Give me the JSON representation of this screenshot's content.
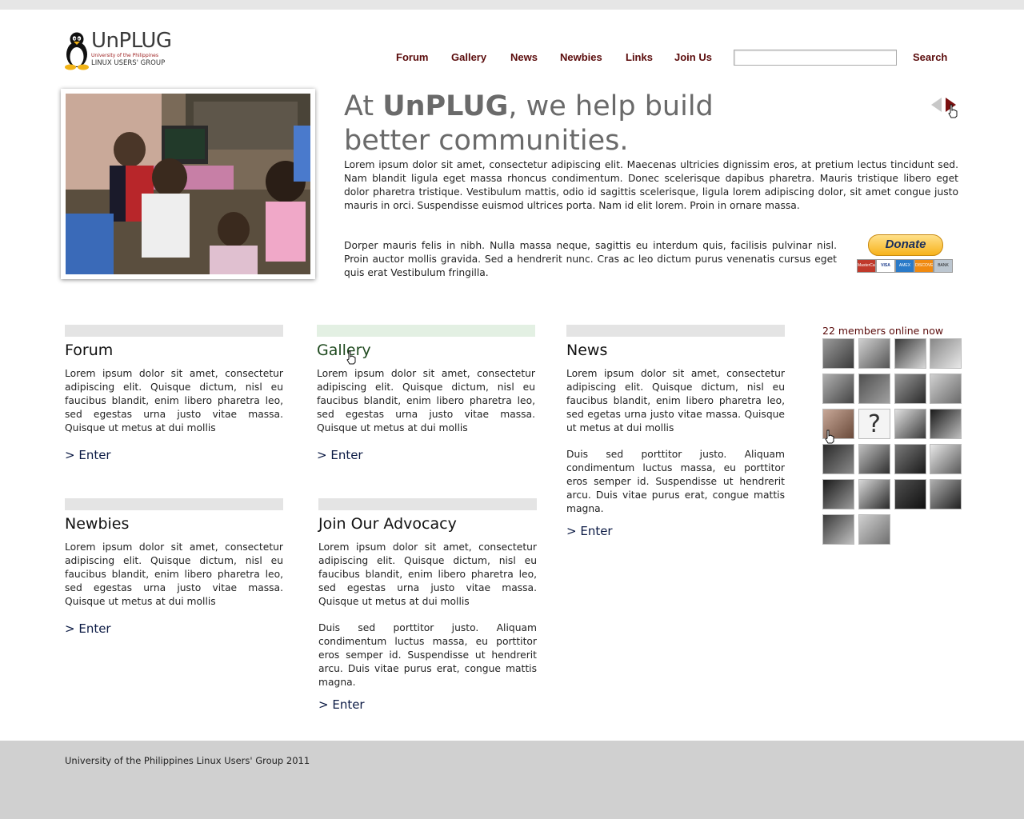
{
  "brand": {
    "name": "UnPLUG",
    "subtitle1": "University of the Philippines",
    "subtitle2": "LINUX USERS' GROUP"
  },
  "nav": {
    "items": [
      "Forum",
      "Gallery",
      "News",
      "Newbies",
      "Links",
      "Join Us"
    ]
  },
  "search": {
    "value": "",
    "button_label": "Search"
  },
  "hero": {
    "title_prefix": "At ",
    "title_brand": "UnPLUG",
    "title_rest": ", we help build better communities.",
    "paragraph1": "Lorem ipsum dolor sit amet, consectetur adipiscing elit. Maecenas ultricies dignissim eros, at pretium lectus tincidunt sed. Nam blandit ligula eget massa rhoncus condimentum. Donec scelerisque dapibus pharetra. Mauris tristique libero eget dolor pharetra tristique. Vestibulum mattis, odio id sagittis scelerisque, ligula lorem adipiscing dolor, sit amet congue justo mauris in orci. Suspendisse euismod ultrices porta. Nam id elit lorem. Proin in ornare massa.",
    "paragraph2": "Dorper mauris felis in nibh. Nulla massa neque, sagittis eu interdum quis, facilisis pulvinar nisl. Proin auctor mollis gravida. Sed a hendrerit nunc. Cras ac leo dictum purus venenatis cursus eget quis erat Vestibulum fringilla."
  },
  "donate": {
    "label": "Donate",
    "cards": [
      "MasterCard",
      "VISA",
      "AMEX",
      "DISCOVER",
      "BANK"
    ]
  },
  "sections": {
    "forum": {
      "title": "Forum",
      "text": "Lorem ipsum dolor sit amet, consectetur adipiscing elit. Quisque dictum, nisl eu faucibus blandit, enim libero pharetra leo, sed egestas urna justo vitae massa. Quisque ut metus at dui mollis",
      "enter": "> Enter"
    },
    "gallery": {
      "title": "Gallery",
      "text": "Lorem ipsum dolor sit amet, consectetur adipiscing elit. Quisque dictum, nisl eu faucibus blandit, enim libero pharetra leo, sed egestas urna justo vitae massa. Quisque ut metus at dui mollis",
      "enter": "> Enter"
    },
    "news": {
      "title": "News",
      "text": "Lorem ipsum dolor sit amet, consectetur adipiscing elit. Quisque dictum, nisl eu faucibus blandit, enim libero pharetra leo, sed egetas urna justo vitae massa. Quisque ut metus at dui mollis",
      "text2": "Duis sed porttitor justo. Aliquam condimentum luctus massa, eu porttitor eros semper id. Suspendisse ut hendrerit arcu. Duis vitae purus erat, congue mattis magna.",
      "enter": "> Enter"
    },
    "newbies": {
      "title": "Newbies",
      "text": "Lorem ipsum dolor sit amet, consectetur adipiscing elit. Quisque dictum, nisl eu faucibus blandit, enim libero pharetra leo, sed egestas urna justo vitae massa. Quisque ut metus at dui mollis",
      "enter": "> Enter"
    },
    "advocacy": {
      "title": "Join Our Advocacy",
      "text": "Lorem ipsum dolor sit amet, consectetur adipiscing elit. Quisque dictum, nisl eu faucibus blandit, enim libero pharetra leo, sed egestas urna justo vitae massa. Quisque ut metus at dui mollis",
      "text2": "Duis sed porttitor justo. Aliquam condimentum luctus massa, eu porttitor eros semper id. Suspendisse ut hendrerit arcu. Duis vitae purus erat, congue mattis magna.",
      "enter": "> Enter"
    }
  },
  "members": {
    "label": "22 members online now",
    "count": 22,
    "unknown_avatar_glyph": "?"
  },
  "footer": {
    "text": "University of the Philippines Linux Users' Group 2011"
  },
  "colors": {
    "nav_text": "#5a0b0b",
    "section_bar": "#e4e4e4",
    "section_bar_active": "#e3f0e3",
    "footer_bg": "#d0d0d0",
    "enter_link": "#0b1a44"
  }
}
